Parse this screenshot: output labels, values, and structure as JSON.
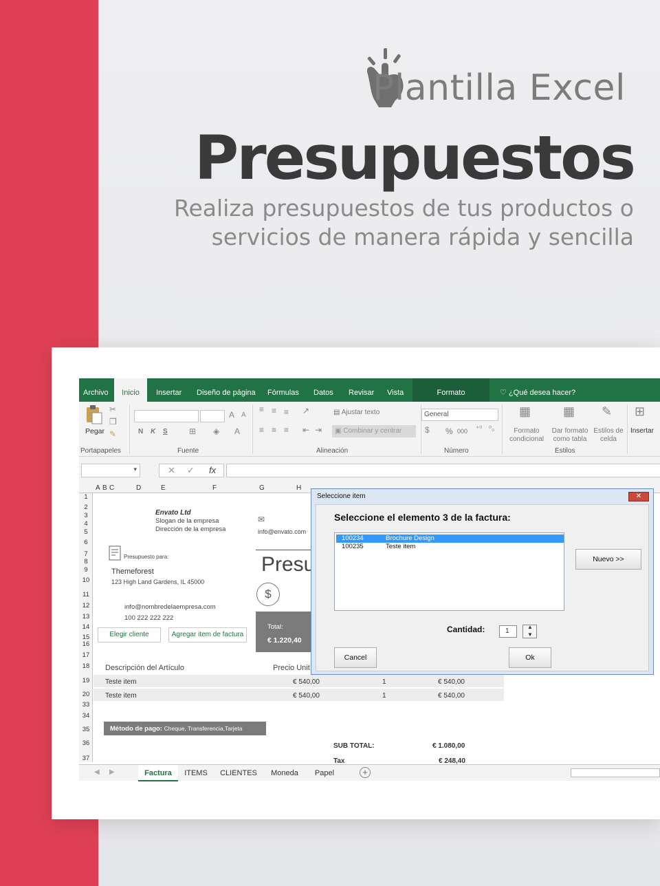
{
  "promo": {
    "subtitle": "Plantilla Excel",
    "title": "Presupuestos",
    "tagline": "Realiza presupuestos de tus productos o servicios de manera rápida y sencilla"
  },
  "colors": {
    "accent_red": "#e04055",
    "excel_green": "#217346"
  },
  "ribbon": {
    "tabs": [
      "Archivo",
      "Inicio",
      "Insertar",
      "Diseño de página",
      "Fórmulas",
      "Datos",
      "Revisar",
      "Vista",
      "Formato"
    ],
    "help": "¿Qué desea hacer?",
    "paste": "Pegar",
    "font_buttons": [
      "N",
      "K",
      "S"
    ],
    "wrap_text": "Ajustar texto",
    "merge_center": "Combinar y centrar",
    "number_format": "General",
    "percent": "%",
    "thousands": "000",
    "cond_format": [
      "Formato",
      "condicional"
    ],
    "table_format": [
      "Dar formato",
      "como tabla"
    ],
    "cell_styles": [
      "Estilos de",
      "celda"
    ],
    "insert": "Insertar",
    "groups": [
      "Portapapeles",
      "Fuente",
      "Alineación",
      "Número",
      "Estilos"
    ]
  },
  "formula_bar": {
    "fx": "fx"
  },
  "columns": [
    "A",
    "B",
    "C",
    "D",
    "E",
    "F",
    "G",
    "H"
  ],
  "rows": [
    "1",
    "2",
    "3",
    "4",
    "5",
    "6",
    "7",
    "8",
    "9",
    "10",
    "11",
    "12",
    "13",
    "14",
    "15",
    "16",
    "17",
    "18",
    "19",
    "20",
    "33",
    "34",
    "35",
    "36",
    "37"
  ],
  "sheet": {
    "company": "Envato Ltd",
    "slogan": "Slogan de la empresa",
    "address": "Dirección de la empresa",
    "email_top": "info@envato.com",
    "budget_for": "Presupuesto para:",
    "client_name": "Themeforest",
    "client_address": "123 High Land Gardens, IL 45000",
    "client_email": "info@nombredelaempresa.com",
    "client_phone": "100 222 222 222",
    "btn_client": "Elegir cliente",
    "btn_add_item": "Agregar item de factura",
    "doc_title": "Presu",
    "total_label": "Total:",
    "total_value": "€ 1.220,40",
    "hdr_desc": "Descripción del Artículo",
    "hdr_price": "Precio Unit",
    "items": [
      {
        "desc": "Teste item",
        "price": "€ 540,00",
        "qty": "1",
        "total": "€ 540,00"
      },
      {
        "desc": "Teste item",
        "price": "€ 540,00",
        "qty": "1",
        "total": "€ 540,00"
      }
    ],
    "payment_label": "Método de pago:",
    "payment_methods": "Cheque, Transferencia,Tarjeta",
    "subtotal_label": "SUB TOTAL:",
    "subtotal_value": "€ 1.080,00",
    "tax_label": "Tax",
    "tax_value": "€ 248,40"
  },
  "sheet_tabs": [
    "Factura",
    "ITEMS",
    "CLIENTES",
    "Moneda",
    "Papel"
  ],
  "dialog": {
    "title": "Seleccione item",
    "close": "✕",
    "heading": "Seleccione el elemento 3 de la factura:",
    "items": [
      {
        "code": "100234",
        "name": "Brochure Design",
        "selected": true
      },
      {
        "code": "100235",
        "name": "Teste item",
        "selected": false
      }
    ],
    "new_button": "Nuevo >>",
    "quantity_label": "Cantidad:",
    "quantity_value": "1",
    "cancel_button": "Cancel",
    "ok_button": "Ok"
  }
}
